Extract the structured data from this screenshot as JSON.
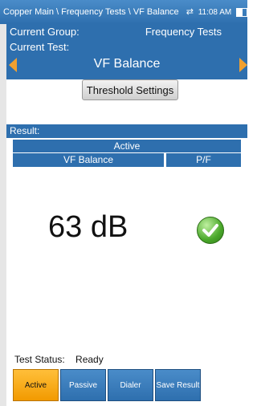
{
  "header": {
    "breadcrumb": "Copper Main \\ Frequency Tests \\ VF Balance",
    "time": "11:08 AM"
  },
  "current_group": {
    "label": "Current Group:",
    "value": "Frequency Tests"
  },
  "current_test": {
    "label": "Current Test:",
    "value": "VF Balance"
  },
  "buttons": {
    "threshold": "Threshold Settings"
  },
  "result": {
    "label": "Result:",
    "mode": "Active",
    "col_vf": "VF Balance",
    "col_pf": "P/F",
    "value": "63 dB",
    "status": "pass"
  },
  "test_status": {
    "label": "Test Status:",
    "value": "Ready"
  },
  "tabs": [
    {
      "label": "Active"
    },
    {
      "label": "Passive"
    },
    {
      "label": "Dialer"
    },
    {
      "label": "Save Result"
    }
  ],
  "colors": {
    "accent": "#2e6fae",
    "active_tab": "#f29a00"
  }
}
